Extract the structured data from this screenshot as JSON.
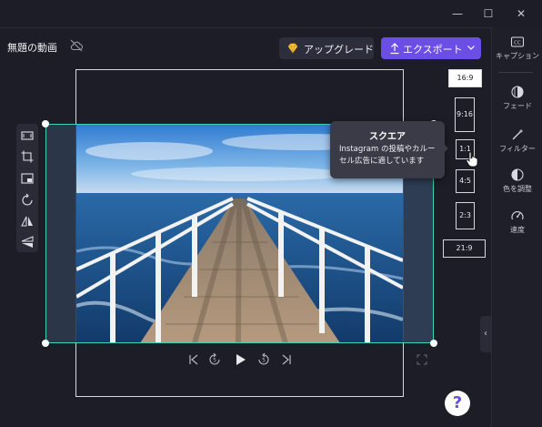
{
  "window": {
    "minimize_glyph": "—",
    "maximize_glyph": "☐",
    "close_glyph": "✕"
  },
  "header": {
    "project_title": "無題の動画",
    "cloud_icon": "cloud-off-icon",
    "upgrade_label": "アップグレード",
    "export_label": "エクスポート"
  },
  "right_panel": {
    "items": [
      {
        "label": "キャプション",
        "icon": "cc-icon"
      },
      {
        "label": "フェード",
        "icon": "fade-icon"
      },
      {
        "label": "フィルター",
        "icon": "filter-wand-icon"
      },
      {
        "label": "色を調整",
        "icon": "color-adjust-icon"
      },
      {
        "label": "速度",
        "icon": "speed-icon"
      }
    ]
  },
  "aspect_ratios": {
    "r169": "16:9",
    "r916": "9:16",
    "r11": "1:1",
    "r45": "4:5",
    "r23": "2:3",
    "r219": "21:9",
    "selected": "16:9"
  },
  "tooltip": {
    "title": "スクエア",
    "description": "Instagram の投稿やカルーセル広告に適しています"
  },
  "help_label": "?",
  "collapse_glyph": "‹",
  "colors": {
    "accent": "#6b4ee6",
    "selection": "#3fd0b8",
    "background": "#1c1d26"
  }
}
